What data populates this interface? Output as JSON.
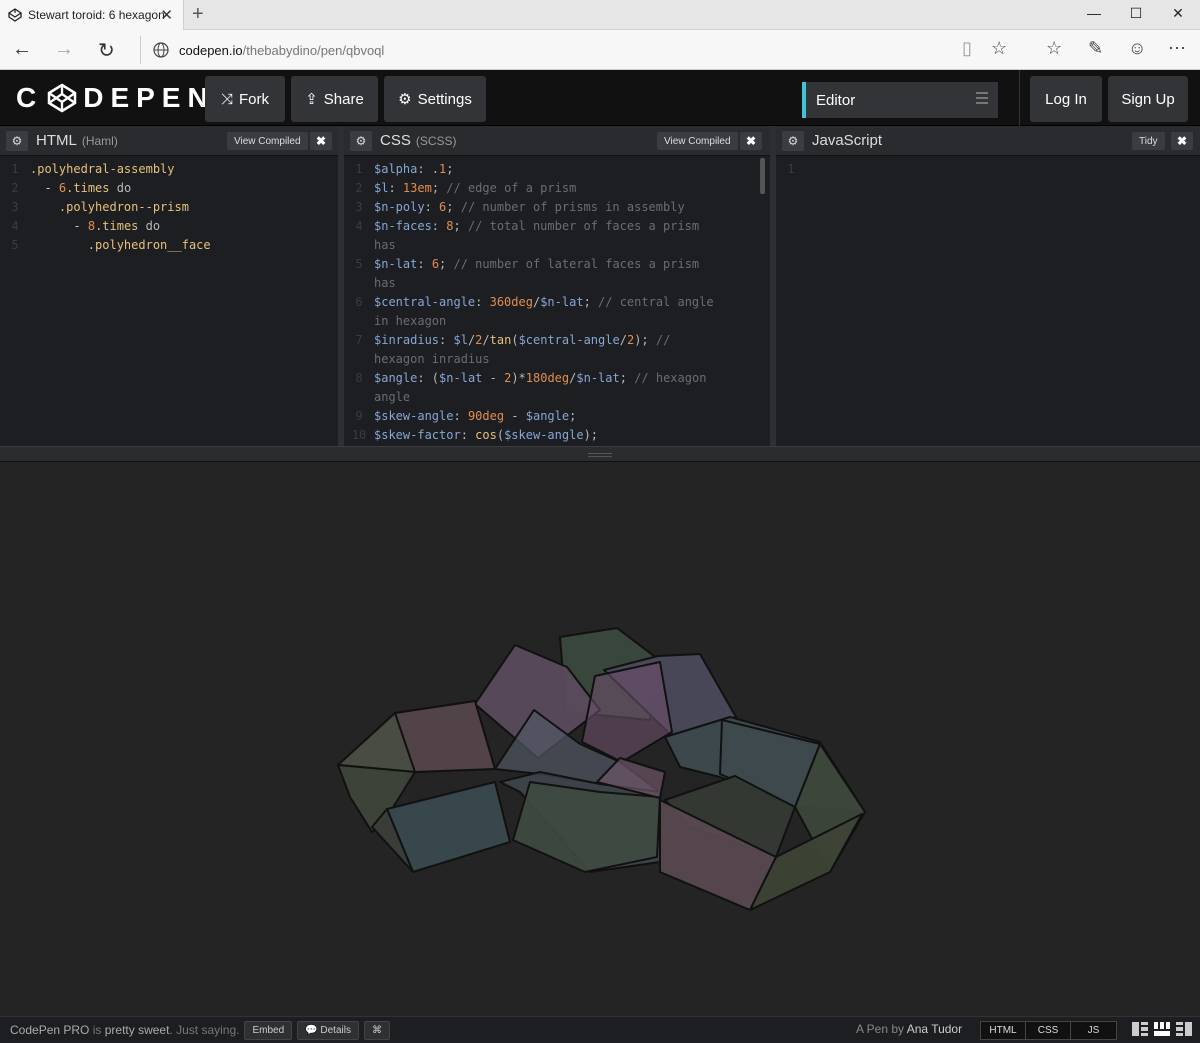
{
  "browser": {
    "tab_title": "Stewart toroid: 6 hexagon",
    "url_host": "codepen.io",
    "url_path": "/thebabydino/pen/qbvoql"
  },
  "header": {
    "logo_text": "CODEPEN",
    "fork_label": "Fork",
    "share_label": "Share",
    "settings_label": "Settings",
    "editor_label": "Editor",
    "login_label": "Log In",
    "signup_label": "Sign Up"
  },
  "panes": {
    "html": {
      "title": "HTML",
      "sub": "(Haml)",
      "view_compiled": "View Compiled",
      "lines": [
        {
          "n": "1",
          "t": ".polyhedral-assembly"
        },
        {
          "n": "2",
          "t": "  - 6.times do"
        },
        {
          "n": "3",
          "t": "    .polyhedron--prism"
        },
        {
          "n": "4",
          "t": "      - 8.times do"
        },
        {
          "n": "5",
          "t": "        .polyhedron__face"
        }
      ]
    },
    "css": {
      "title": "CSS",
      "sub": "(SCSS)",
      "view_compiled": "View Compiled",
      "lines": [
        {
          "n": "1",
          "t": "$alpha: .1;"
        },
        {
          "n": "2",
          "t": "$l: 13em; // edge of a prism"
        },
        {
          "n": "3",
          "t": "$n-poly: 6; // number of prisms in assembly"
        },
        {
          "n": "4",
          "t": "$n-faces: 8; // total number of faces a prism has"
        },
        {
          "n": "5",
          "t": "$n-lat: 6; // number of lateral faces a prism has"
        },
        {
          "n": "6",
          "t": "$central-angle: 360deg/$n-lat; // central angle in hexagon"
        },
        {
          "n": "7",
          "t": "$inradius: $l/2/tan($central-angle/2); // hexagon inradius"
        },
        {
          "n": "8",
          "t": "$angle: ($n-lat - 2)*180deg/$n-lat; // hexagon angle"
        },
        {
          "n": "9",
          "t": "$skew-angle: 90deg - $angle;"
        },
        {
          "n": "10",
          "t": "$skew-factor: cos($skew-angle);"
        }
      ]
    },
    "js": {
      "title": "JavaScript",
      "tidy": "Tidy",
      "lines": [
        {
          "n": "1",
          "t": ""
        }
      ]
    }
  },
  "footer": {
    "pro_prefix": "CodePen PRO",
    "pro_mid": " is ",
    "pro_strong": "pretty sweet",
    "pro_suffix": ". Just saying.",
    "embed": "Embed",
    "details": "Details",
    "shortcut": "⌘",
    "credit_prefix": "A Pen by ",
    "author": "Ana Tudor",
    "view_html": "HTML",
    "view_css": "CSS",
    "view_js": "JS"
  },
  "colors": {
    "accent": "#40c3d6",
    "bg": "#1d1e22",
    "preview_bg": "#242424"
  }
}
